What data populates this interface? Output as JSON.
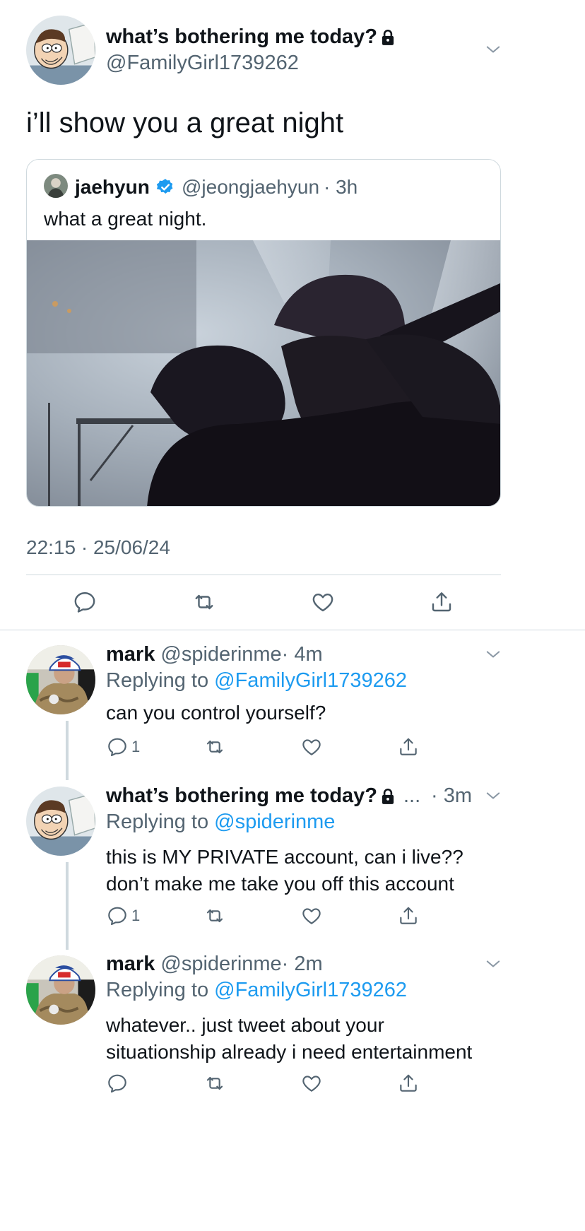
{
  "main_tweet": {
    "display_name": "what’s bothering me today?",
    "handle": "@FamilyGirl1739262",
    "text": "i’ll show you a great night",
    "timestamp": "22:15 · 25/06/24"
  },
  "quoted_tweet": {
    "display_name": "jaehyun",
    "handle": "@jeongjaehyun",
    "time": "· 3h",
    "text": "what a great night."
  },
  "replies": [
    {
      "display_name": "mark",
      "handle": "@spiderinme",
      "time": "· 4m",
      "replying_label": "Replying to",
      "replying_to": "@FamilyGirl1739262",
      "text_lines": [
        "can you control yourself?"
      ],
      "reply_count": "1"
    },
    {
      "display_name": "what’s bothering me today?",
      "ellipsis": "...",
      "time": "· 3m",
      "replying_label": "Replying to",
      "replying_to": "@spiderinme",
      "text_lines": [
        "this is MY PRIVATE account, can i live??",
        "don’t make me take you off this account"
      ],
      "reply_count": "1"
    },
    {
      "display_name": "mark",
      "handle": "@spiderinme",
      "time": "· 2m",
      "replying_label": "Replying to",
      "replying_to": "@FamilyGirl1739262",
      "text_lines": [
        "whatever.. just tweet about your",
        "situationship already i need entertainment"
      ],
      "reply_count": ""
    }
  ],
  "icons": {
    "lock": "lock-icon",
    "verified": "verified-badge-icon",
    "chevron": "chevron-down-icon",
    "reply": "reply-icon",
    "retweet": "retweet-icon",
    "like": "like-icon",
    "share": "share-icon"
  },
  "colors": {
    "text": "#0f1419",
    "muted": "#536471",
    "link": "#1d9bf0",
    "divider": "#cfd9de"
  }
}
